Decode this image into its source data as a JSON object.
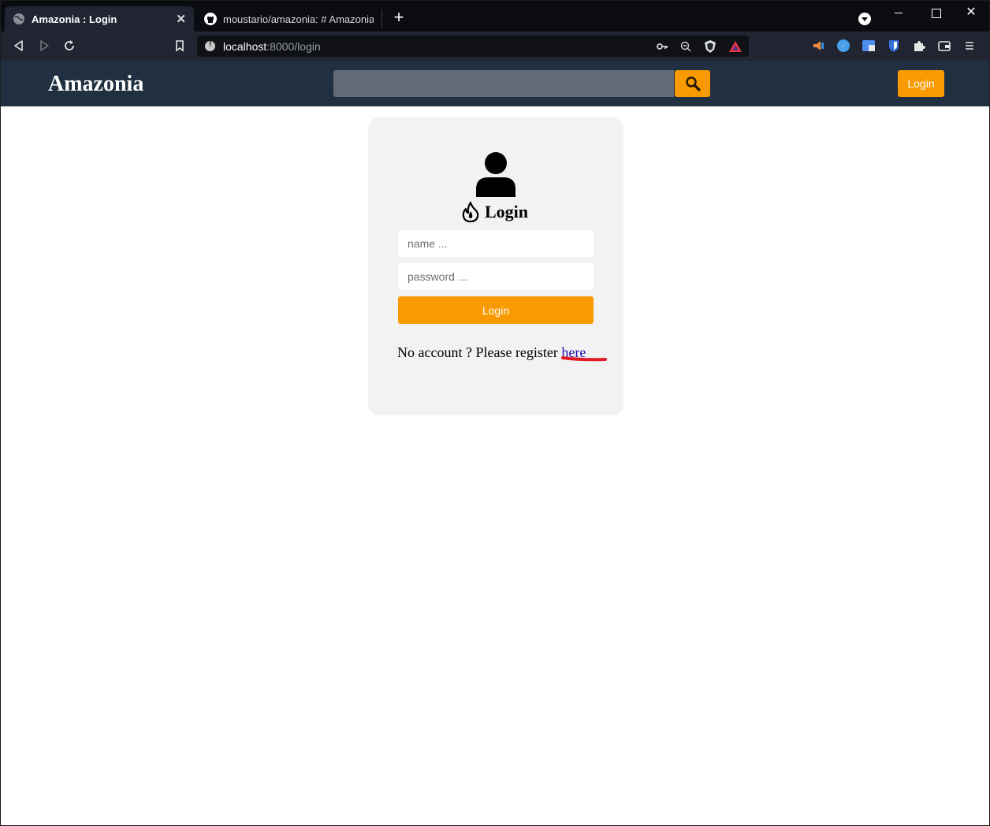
{
  "browser": {
    "tabs": [
      {
        "label": "Amazonia : Login",
        "active": true,
        "icon": "globe-icon"
      },
      {
        "label": "moustario/amazonia: # Amazonia",
        "active": false,
        "icon": "github-icon"
      }
    ],
    "new_tab_label": "+",
    "close_label": "✕",
    "url": {
      "host": "localhost",
      "path": ":8000/login"
    }
  },
  "header": {
    "brand": "Amazonia",
    "search_placeholder": "",
    "login_label": "Login"
  },
  "login_form": {
    "title": "Login",
    "name_placeholder": "name ...",
    "password_placeholder": "password ...",
    "submit_label": "Login",
    "register_text": "No account ? Please register ",
    "register_link": "here"
  },
  "colors": {
    "accent": "#f99b00",
    "header_bg": "#203040",
    "card_bg": "#f2f2f2",
    "link": "#1a0dab",
    "annotation": "#e01b24"
  }
}
